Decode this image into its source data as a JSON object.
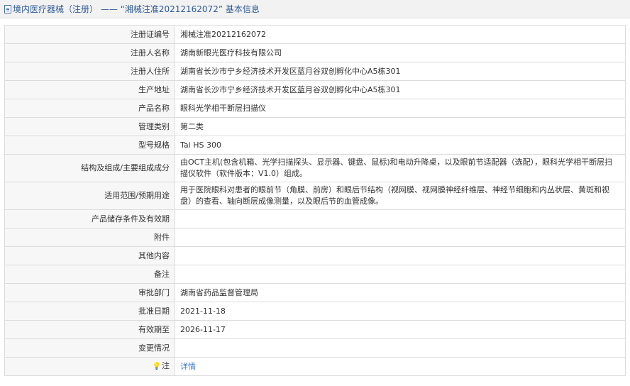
{
  "header": {
    "title": "境内医疗器械（注册） —— “湘械注准20212162072” 基本信息",
    "icon": "document-icon"
  },
  "rows": [
    {
      "label": "注册证编号",
      "value": "湘械注准20212162072"
    },
    {
      "label": "注册人名称",
      "value": "湖南新眼光医疗科技有限公司"
    },
    {
      "label": "注册人住所",
      "value": "湖南省长沙市宁乡经济技术开发区蓝月谷双创孵化中心A5栋301"
    },
    {
      "label": "生产地址",
      "value": "湖南省长沙市宁乡经济技术开发区蓝月谷双创孵化中心A5栋301"
    },
    {
      "label": "产品名称",
      "value": "眼科光学相干断层扫描仪"
    },
    {
      "label": "管理类别",
      "value": "第二类"
    },
    {
      "label": "型号规格",
      "value": "Tai HS 300"
    },
    {
      "label": "结构及组成/主要组成成分",
      "value": "由OCT主机(包含机箱、光学扫描探头、显示器、键盘、鼠标)和电动升降桌，以及眼前节适配器（选配），眼科光学相干断层扫描仪软件（软件版本：V1.0）组成。"
    },
    {
      "label": "适用范围/预期用途",
      "value": "用于医院眼科对患者的眼前节（角膜、前房）和眼后节结构（视网膜、视网膜神经纤维层、神经节细胞和内丛状层、黄斑和视盘）的查看、轴向断层成像测量，以及眼后节的血管成像。"
    },
    {
      "label": "产品储存条件及有效期",
      "value": ""
    },
    {
      "label": "附件",
      "value": ""
    },
    {
      "label": "其他内容",
      "value": ""
    },
    {
      "label": "备注",
      "value": ""
    },
    {
      "label": "审批部门",
      "value": "湖南省药品监督管理局"
    },
    {
      "label": "批准日期",
      "value": "2021-11-18"
    },
    {
      "label": "有效期至",
      "value": "2026-11-17"
    },
    {
      "label": "变更情况",
      "value": ""
    }
  ],
  "note": {
    "icon": "lightbulb-icon",
    "icon_glyph": "💡",
    "label": "注",
    "link_text": "详情"
  }
}
